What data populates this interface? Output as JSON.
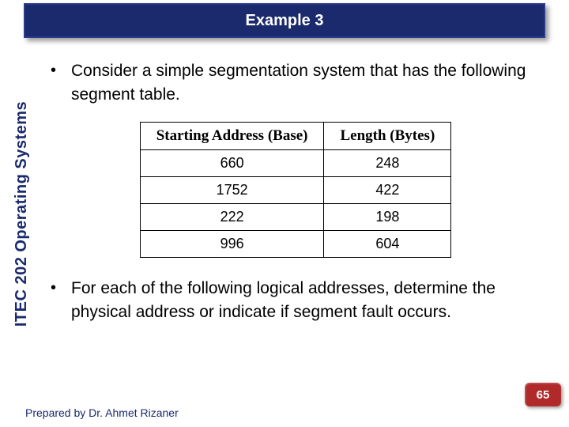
{
  "title": "Example 3",
  "sidebar_label": "ITEC 202 Operating Systems",
  "bullets": [
    "Consider a simple segmentation system that has the following segment table.",
    "For each of the following logical addresses, determine the physical address or indicate if segment fault occurs."
  ],
  "chart_data": {
    "type": "table",
    "headers": [
      "Starting Address (Base)",
      "Length (Bytes)"
    ],
    "rows": [
      [
        660,
        248
      ],
      [
        1752,
        422
      ],
      [
        222,
        198
      ],
      [
        996,
        604
      ]
    ]
  },
  "footer": "Prepared by Dr. Ahmet Rizaner",
  "page_number": "65"
}
